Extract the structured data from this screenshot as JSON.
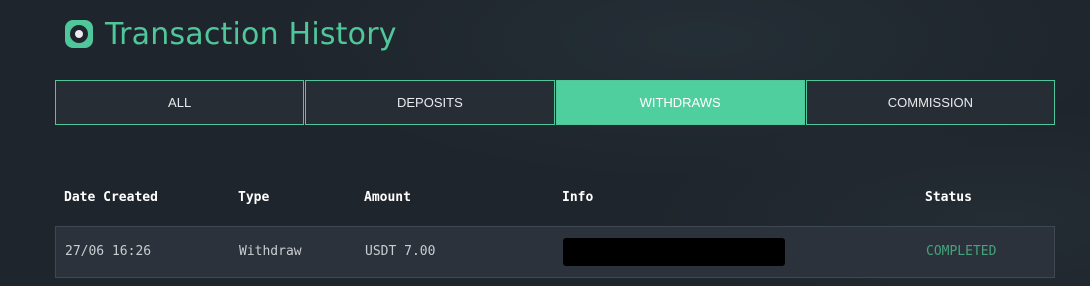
{
  "header": {
    "title": "Transaction History",
    "logo_icon": "coin-logo-icon"
  },
  "tabs": [
    {
      "label": "ALL",
      "active": false
    },
    {
      "label": "DEPOSITS",
      "active": false
    },
    {
      "label": "WITHDRAWS",
      "active": true
    },
    {
      "label": "COMMISSION",
      "active": false
    }
  ],
  "table": {
    "columns": [
      "Date Created",
      "Type",
      "Amount",
      "Info",
      "Status"
    ],
    "rows": [
      {
        "date": "27/06 16:26",
        "type": "Withdraw",
        "amount": "USDT 7.00",
        "info": "",
        "status": "COMPLETED"
      }
    ]
  },
  "colors": {
    "accent": "#4fc79a",
    "background": "#1f252c",
    "status_completed": "#45a37c"
  }
}
